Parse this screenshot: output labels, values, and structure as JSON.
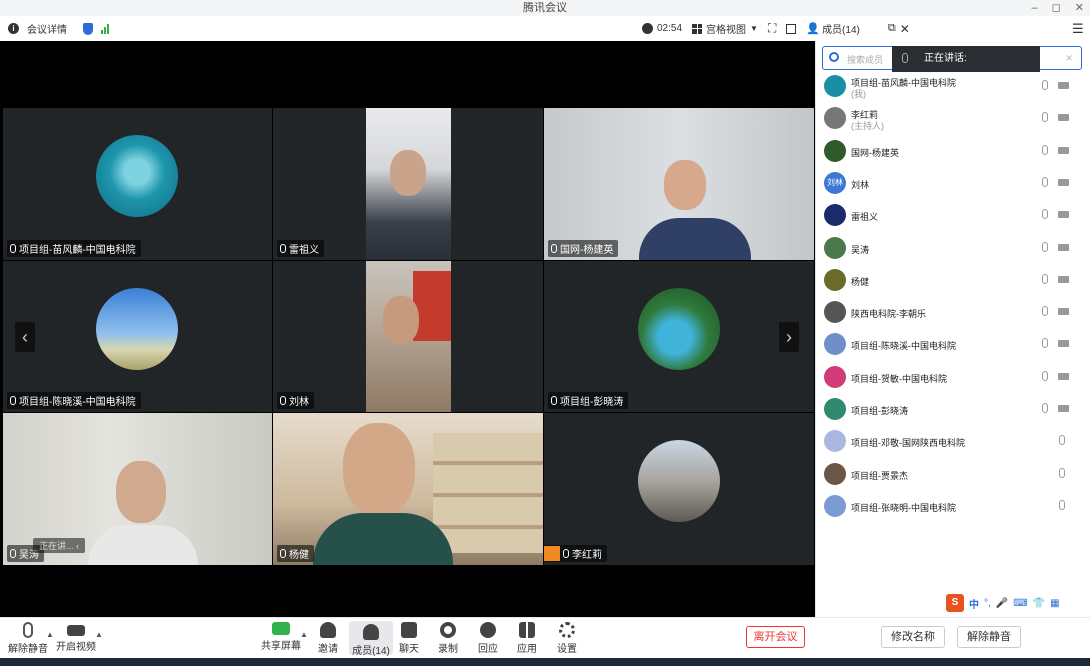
{
  "window": {
    "title": "腾讯会议",
    "controls": [
      "–",
      "◻",
      "✕"
    ]
  },
  "toolbar": {
    "meeting_info": "会议详情",
    "timer": "02:54",
    "view_mode": "宫格视图",
    "members_label": "成员(14)"
  },
  "tiles": [
    {
      "name": "项目组-苗风麟-中国电科院"
    },
    {
      "name": "雷祖义"
    },
    {
      "name": "国网-杨建英"
    },
    {
      "name": "项目组-陈晓溪-中国电科院"
    },
    {
      "name": "刘林"
    },
    {
      "name": "项目组-彭晓涛"
    },
    {
      "name": "吴涛",
      "overlay": "正在讲..."
    },
    {
      "name": "杨健"
    },
    {
      "name": "李红莉"
    }
  ],
  "nav": {
    "prev": "‹",
    "next": "›"
  },
  "bottom": {
    "unmute": "解除静音",
    "start_video": "开启视频",
    "share": "共享屏幕",
    "invite": "邀请",
    "members": "成员(14)",
    "chat": "聊天",
    "record": "录制",
    "playback": "回应",
    "apps": "应用",
    "settings": "设置",
    "leave": "离开会议",
    "rename": "修改名称",
    "mute_all": "解除静音"
  },
  "panel": {
    "search_placeholder": "搜索成员",
    "speaking": "正在讲话:",
    "participants": [
      {
        "name": "项目组-苗风麟-中国电科院",
        "sub": "(我)",
        "color": "#1a8fa3"
      },
      {
        "name": "李红莉",
        "sub": "(主持人)",
        "color": "#777"
      },
      {
        "name": "国网-杨建英",
        "sub": "",
        "color": "#2f5a2a"
      },
      {
        "name": "刘林",
        "sub": "",
        "color": "#3b78d8",
        "initials": "刘林"
      },
      {
        "name": "雷祖义",
        "sub": "",
        "color": "#1b2a6b"
      },
      {
        "name": "吴涛",
        "sub": "",
        "color": "#4a7a4a"
      },
      {
        "name": "杨健",
        "sub": "",
        "color": "#6b6b2a"
      },
      {
        "name": "陕西电科院-李朝乐",
        "sub": "",
        "color": "#555"
      },
      {
        "name": "项目组-陈晓溪-中国电科院",
        "sub": "",
        "color": "#6e8fc8"
      },
      {
        "name": "项目组-贺敏-中国电科院",
        "sub": "",
        "color": "#d23a7a"
      },
      {
        "name": "项目组-彭晓涛",
        "sub": "",
        "color": "#2f8a6f"
      },
      {
        "name": "项目组-邓敬-国网陕西电科院",
        "sub": "",
        "color": "#a9b8e0"
      },
      {
        "name": "项目组-贾景杰",
        "sub": "",
        "color": "#6b5545"
      },
      {
        "name": "项目组-张晓明-中国电科院",
        "sub": "",
        "color": "#7a9bd4"
      }
    ],
    "ime_label": "中"
  }
}
